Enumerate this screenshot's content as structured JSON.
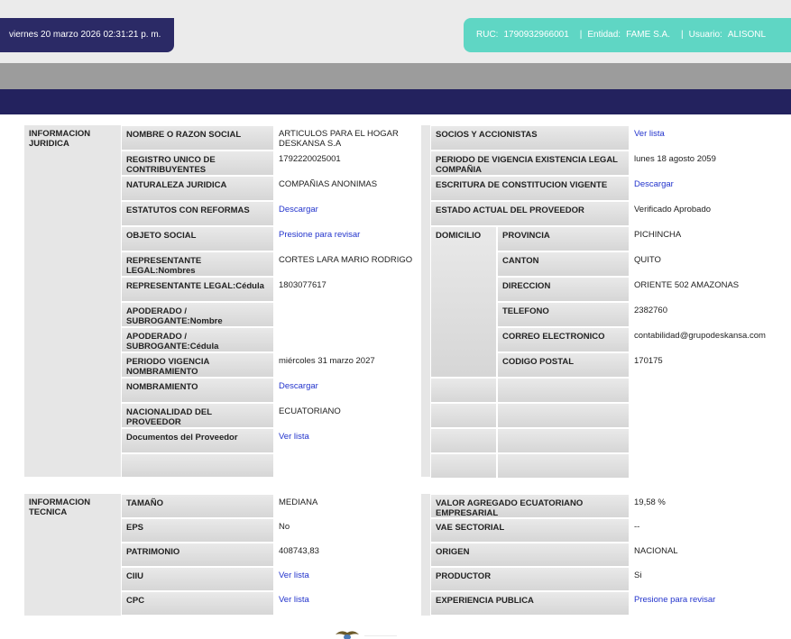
{
  "header": {
    "datetime": "viernes 20 marzo 2026 02:31:21 p. m.",
    "ruc_label": "RUC:",
    "ruc_value": "1790932966001",
    "entidad_label": "Entidad:",
    "entidad_value": "FAME S.A.",
    "usuario_label": "Usuario:",
    "usuario_value": "ALISONL",
    "separator": "|"
  },
  "juridica": {
    "title": "INFORMACION JURIDICA",
    "left_rows": [
      {
        "label": "NOMBRE O RAZON SOCIAL",
        "value": "ARTICULOS PARA EL HOGAR DESKANSA S.A"
      },
      {
        "label": "REGISTRO UNICO DE CONTRIBUYENTES",
        "value": "1792220025001"
      },
      {
        "label": "NATURALEZA JURIDICA",
        "value": "COMPAÑIAS ANONIMAS"
      },
      {
        "label": "ESTATUTOS CON REFORMAS",
        "value": "Descargar"
      },
      {
        "label": "OBJETO SOCIAL",
        "value": "Presione para revisar"
      },
      {
        "label": "REPRESENTANTE LEGAL:Nombres",
        "value": "CORTES LARA MARIO RODRIGO"
      },
      {
        "label": "REPRESENTANTE LEGAL:Cédula",
        "value": "1803077617"
      },
      {
        "label": "APODERADO / SUBROGANTE:Nombre",
        "value": ""
      },
      {
        "label": "APODERADO / SUBROGANTE:Cédula",
        "value": ""
      },
      {
        "label": "PERIODO VIGENCIA NOMBRAMIENTO",
        "value": "miércoles 31 marzo 2027"
      },
      {
        "label": "NOMBRAMIENTO",
        "value": "Descargar"
      },
      {
        "label": "NACIONALIDAD DEL PROVEEDOR",
        "value": "ECUATORIANO"
      },
      {
        "label": "Documentos del Proveedor",
        "value": "Ver lista"
      }
    ],
    "right_rows": [
      {
        "label": "SOCIOS Y ACCIONISTAS",
        "value": "Ver lista"
      },
      {
        "label": "PERIODO DE VIGENCIA EXISTENCIA LEGAL COMPAÑIA",
        "value": "lunes 18 agosto 2059"
      },
      {
        "label": "ESCRITURA DE CONSTITUCION VIGENTE",
        "value": "Descargar"
      },
      {
        "label": "ESTADO ACTUAL DEL PROVEEDOR",
        "value": "Verificado Aprobado"
      }
    ],
    "domicilio_label": "DOMICILIO",
    "domicilio_rows": [
      {
        "label": "PROVINCIA",
        "value": "PICHINCHA"
      },
      {
        "label": "CANTON",
        "value": "QUITO"
      },
      {
        "label": "DIRECCION",
        "value": "ORIENTE 502 AMAZONAS"
      },
      {
        "label": "TELEFONO",
        "value": "2382760"
      },
      {
        "label": "CORREO ELECTRONICO",
        "value": "contabilidad@grupodeskansa.com"
      },
      {
        "label": "CODIGO POSTAL",
        "value": "170175"
      }
    ]
  },
  "tecnica": {
    "title": "INFORMACION TECNICA",
    "left_rows": [
      {
        "label": "TAMAÑO",
        "value": "MEDIANA"
      },
      {
        "label": "EPS",
        "value": "No"
      },
      {
        "label": "PATRIMONIO",
        "value": "408743,83"
      },
      {
        "label": "CIIU",
        "value": "Ver lista"
      },
      {
        "label": "CPC",
        "value": "Ver lista"
      }
    ],
    "right_rows": [
      {
        "label": "VALOR AGREGADO ECUATORIANO EMPRESARIAL",
        "value": "19,58 %"
      },
      {
        "label": "VAE SECTORIAL",
        "value": "--"
      },
      {
        "label": "ORIGEN",
        "value": "NACIONAL"
      },
      {
        "label": "PRODUCTOR",
        "value": "Si"
      },
      {
        "label": "EXPERIENCIA PUBLICA",
        "value": "Presione para revisar"
      }
    ]
  },
  "footer": {
    "emblem": "ecuador-coat-of-arms-icon"
  }
}
